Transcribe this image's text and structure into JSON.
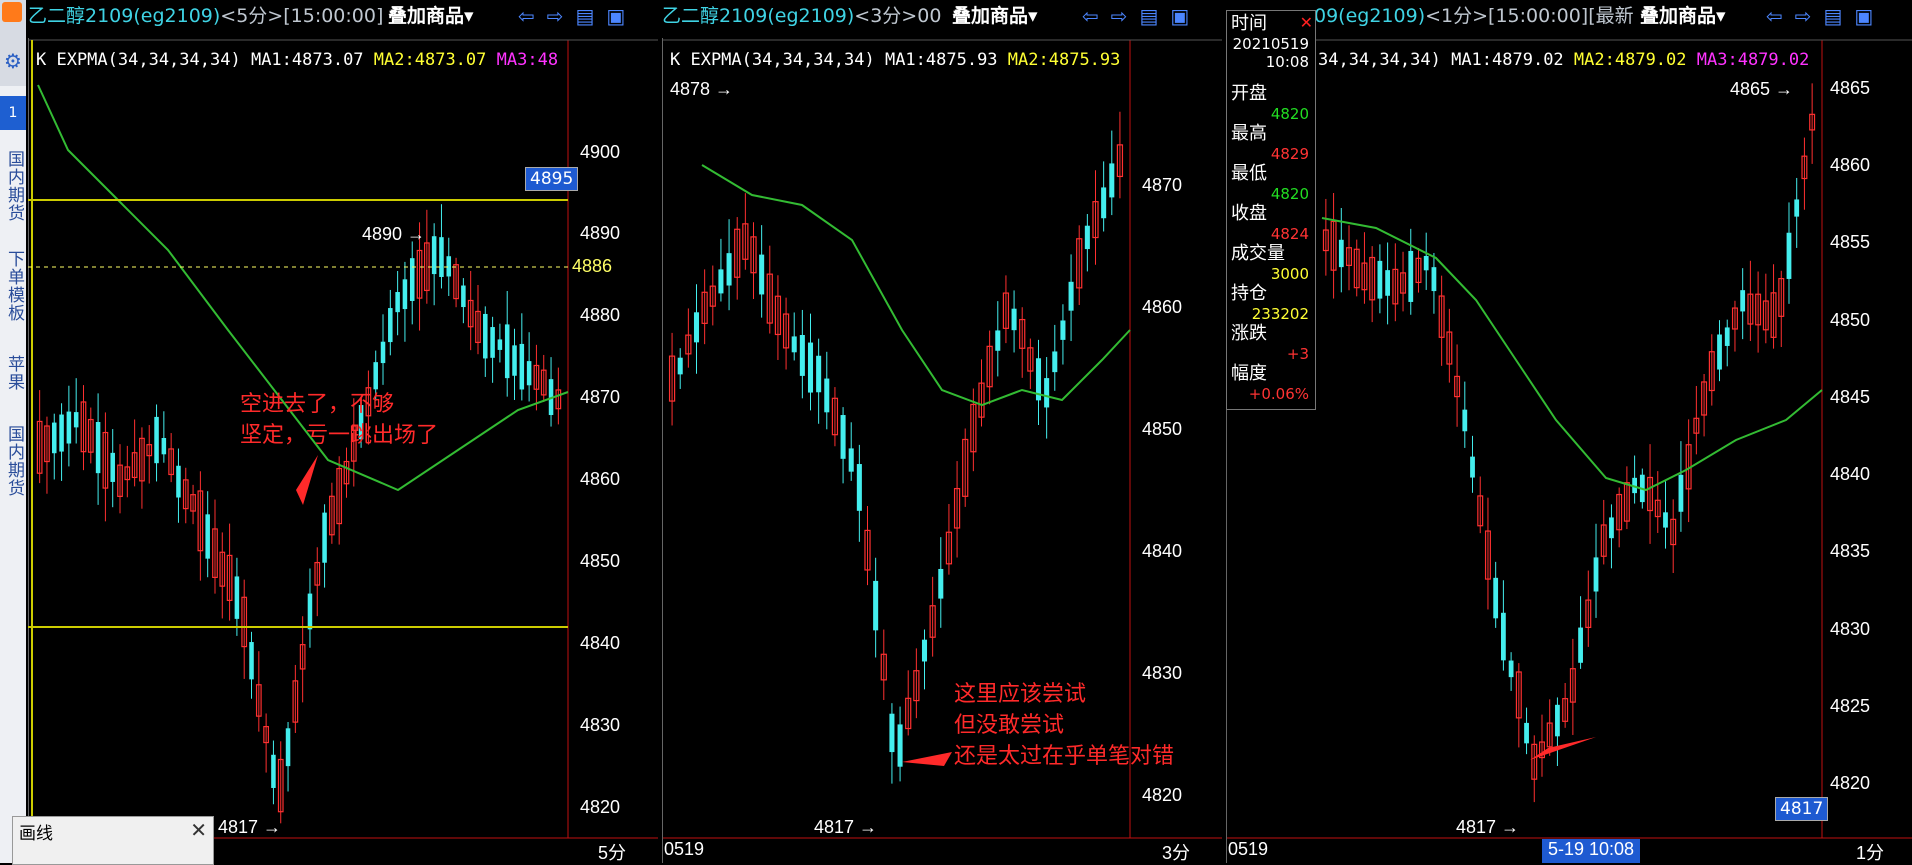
{
  "sidebar": {
    "badge": "1",
    "labels": [
      "国内期货",
      "下单模板",
      "苹果",
      "国内期货"
    ]
  },
  "panels": [
    {
      "title_main": "乙二醇2109(eg2109)",
      "title_rest": "<5分>[15:00:00]",
      "overlay_label": "叠加商品▾",
      "indicator": {
        "prefix": "K EXPMA(34,34,34,34)",
        "ma1": "MA1:4873.07",
        "ma2": "MA2:4873.07",
        "ma3": "MA3:48"
      },
      "axis_ticks": [
        "4900",
        "4890",
        "4880",
        "4870",
        "4860",
        "4850",
        "4840",
        "4830",
        "4820"
      ],
      "price_badge": "4895",
      "dashed_label": "4886",
      "high_mark": "4890 →",
      "low_mark": "4817 →",
      "annotation": [
        "空进去了，不够",
        "坚定，亏一跳出场了"
      ],
      "footer_right": "5分"
    },
    {
      "title_main": "乙二醇2109(eg2109)",
      "title_rest": "<3分>00",
      "overlay_label": "叠加商品▾",
      "indicator": {
        "prefix": "K EXPMA(34,34,34,34)",
        "ma1": "MA1:4875.93",
        "ma2": "MA2:4875.93"
      },
      "axis_ticks": [
        "4870",
        "4860",
        "4850",
        "4840",
        "4830",
        "4820"
      ],
      "high_mark": "4878 →",
      "low_mark": "4817 →",
      "annotation": [
        "这里应该尝试",
        "但没敢尝试",
        "还是太过在乎单笔对错"
      ],
      "footer_left": "0519",
      "footer_right": "3分"
    },
    {
      "title_main": "09(eg2109)",
      "title_rest": "<1分>[15:00:00][最新",
      "overlay_label": "叠加商品▾",
      "indicator": {
        "prefix": "34,34,34,34)",
        "ma1": "MA1:4879.02",
        "ma2": "MA2:4879.02",
        "ma3": "MA3:4879.02"
      },
      "axis_ticks": [
        "4865",
        "4860",
        "4855",
        "4850",
        "4845",
        "4840",
        "4835",
        "4830",
        "4825",
        "4820"
      ],
      "price_badge": "4817",
      "high_mark": "4865 →",
      "low_mark": "4817 →",
      "footer_left": "0519",
      "footer_time": "5-19 10:08",
      "footer_right": "1分"
    }
  ],
  "infobox": {
    "rows": [
      {
        "label": "时间",
        "value": "20210519",
        "value2": "10:08",
        "color": "#ffffff"
      },
      {
        "label": "开盘",
        "value": "4820",
        "color": "#22dd22"
      },
      {
        "label": "最高",
        "value": "4829",
        "color": "#ff3333"
      },
      {
        "label": "最低",
        "value": "4820",
        "color": "#22dd22"
      },
      {
        "label": "收盘",
        "value": "4824",
        "color": "#ff3333"
      },
      {
        "label": "成交量",
        "value": "3000",
        "color": "#ffff33"
      },
      {
        "label": "持仓",
        "value": "233202",
        "color": "#ffff33"
      },
      {
        "label": "涨跌",
        "value": "+3",
        "color": "#ff3333"
      },
      {
        "label": "幅度",
        "value": "+0.06%",
        "color": "#ff3333"
      }
    ]
  },
  "drawtool": {
    "title": "画线"
  },
  "colors": {
    "up": "#ff3030",
    "down": "#44eeee",
    "ma": "#33bb33",
    "hline": "#cccc00",
    "axis": "#c01010"
  }
}
